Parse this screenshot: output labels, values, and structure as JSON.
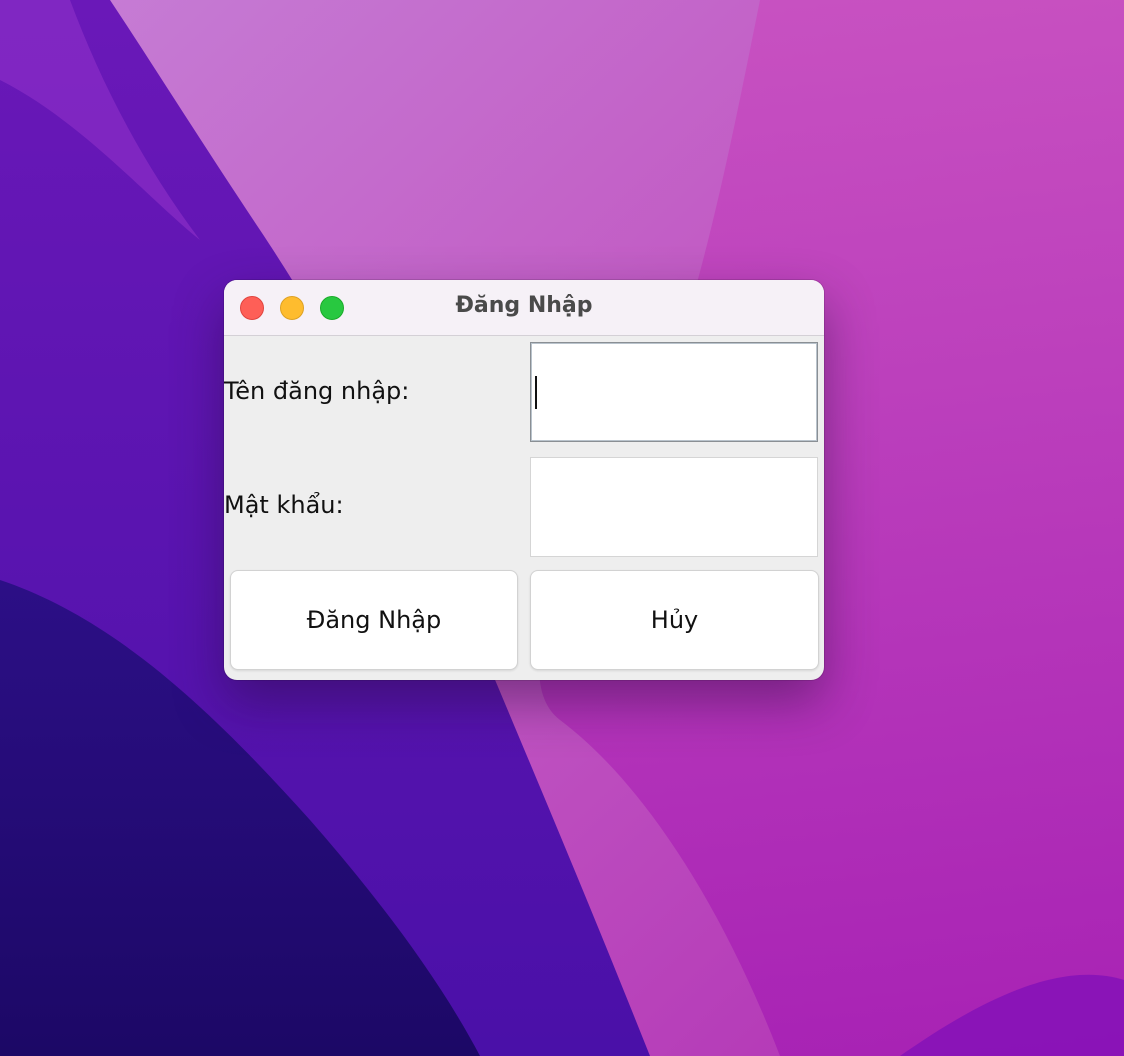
{
  "window": {
    "title": "Đăng Nhập"
  },
  "form": {
    "username_label": "Tên đăng nhập:",
    "username_value": "",
    "password_label": "Mật khẩu:",
    "password_value": ""
  },
  "buttons": {
    "login_label": "Đăng Nhập",
    "cancel_label": "Hủy"
  },
  "colors": {
    "close": "#fe5f57",
    "minimize": "#febc2e",
    "zoom": "#28c840",
    "window_bg": "#eeeeee"
  }
}
